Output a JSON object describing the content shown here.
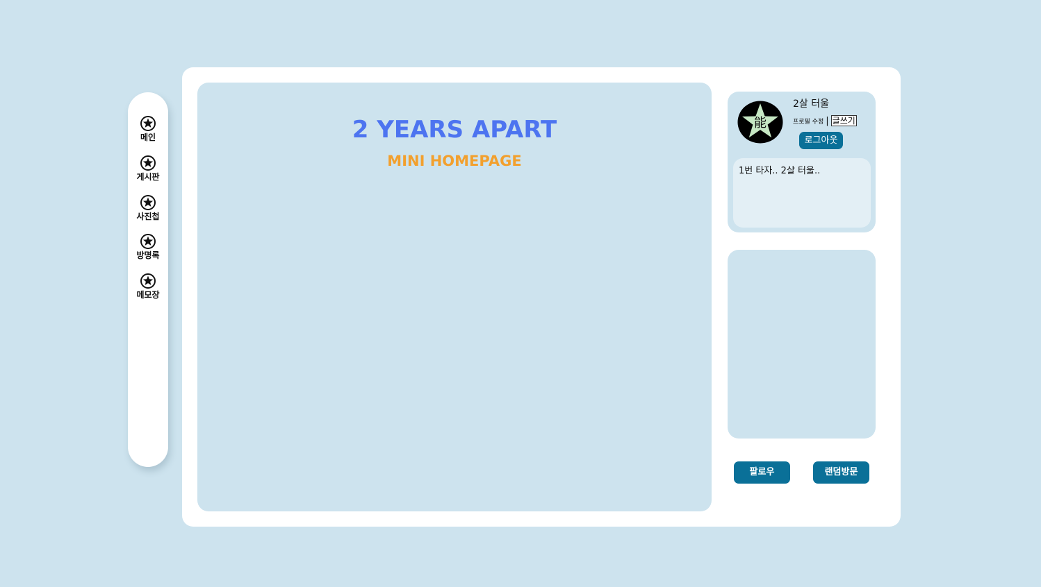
{
  "nav": {
    "items": [
      {
        "label": "메인",
        "icon": "star-icon"
      },
      {
        "label": "게시판",
        "icon": "star-icon"
      },
      {
        "label": "사진첩",
        "icon": "star-icon"
      },
      {
        "label": "방명록",
        "icon": "star-icon"
      },
      {
        "label": "메모장",
        "icon": "star-icon"
      }
    ]
  },
  "main": {
    "title": "2 YEARS APART",
    "subtitle": "MINI HOMEPAGE"
  },
  "profile": {
    "avatar_glyph": "能",
    "nickname": "2살 터울",
    "edit_label": "프로필 수정",
    "separator": "|",
    "write_label": "글쓰기",
    "logout_label": "로그아웃",
    "bio": "1번 타자.. 2살 터울.."
  },
  "actions": {
    "follow_label": "팔로우",
    "random_visit_label": "랜덤방문"
  },
  "colors": {
    "background": "#cde3ee",
    "title": "#4d74f0",
    "subtitle": "#f2a02e",
    "button": "#0a7098",
    "avatar_star": "#c6e8c4"
  }
}
